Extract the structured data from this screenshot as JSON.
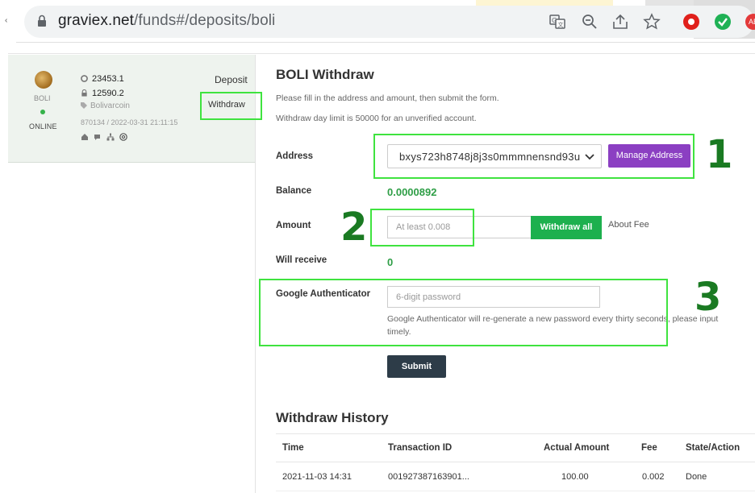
{
  "browser": {
    "url_host": "graviex.net",
    "url_path": "/funds#/deposits/boli",
    "back_mark": "‹",
    "avatar_text": "AB"
  },
  "coin_card": {
    "code": "BOLI",
    "status": "ONLINE",
    "stat_circle": "23453.1",
    "stat_locked": "12590.2",
    "name": "Bolivarcoin",
    "meta": "870134 / 2022-03-31 21:11:15",
    "nav_deposit": "Deposit",
    "nav_withdraw": "Withdraw"
  },
  "form": {
    "title": "BOLI Withdraw",
    "desc1": "Please fill in the address and amount, then submit the form.",
    "desc2": "Withdraw day limit is 50000 for an unverified account.",
    "address_label": "Address",
    "address_value": "bxys723h8748j8j3s0mmmnensnd93u",
    "manage_address": "Manage Address",
    "balance_label": "Balance",
    "balance_value": "0.0000892",
    "amount_label": "Amount",
    "amount_placeholder": "At least 0.008",
    "withdraw_all": "Withdraw all",
    "about_fee": "About Fee",
    "will_receive_label": "Will receive",
    "will_receive_value": "0",
    "ga_label": "Google Authenticator",
    "ga_placeholder": "6-digit password",
    "ga_help": "Google Authenticator will re-generate a new password every thirty seconds, please input timely.",
    "submit": "Submit"
  },
  "history": {
    "title": "Withdraw History",
    "columns": [
      "Time",
      "Transaction ID",
      "Actual Amount",
      "Fee",
      "State/Action"
    ],
    "rows": [
      [
        "2021-11-03 14:31",
        "001927387163901...",
        "100.00",
        "0.002",
        "Done"
      ]
    ]
  },
  "annotations": [
    "1",
    "2",
    "3"
  ],
  "colors": {
    "highlight": "#3fe33f",
    "annotation": "#1a7a22",
    "manage_button": "#8b3fc2",
    "withdraw_all_button": "#1db04e",
    "submit_button": "#2d3c48",
    "value_green": "#2e9e46"
  }
}
